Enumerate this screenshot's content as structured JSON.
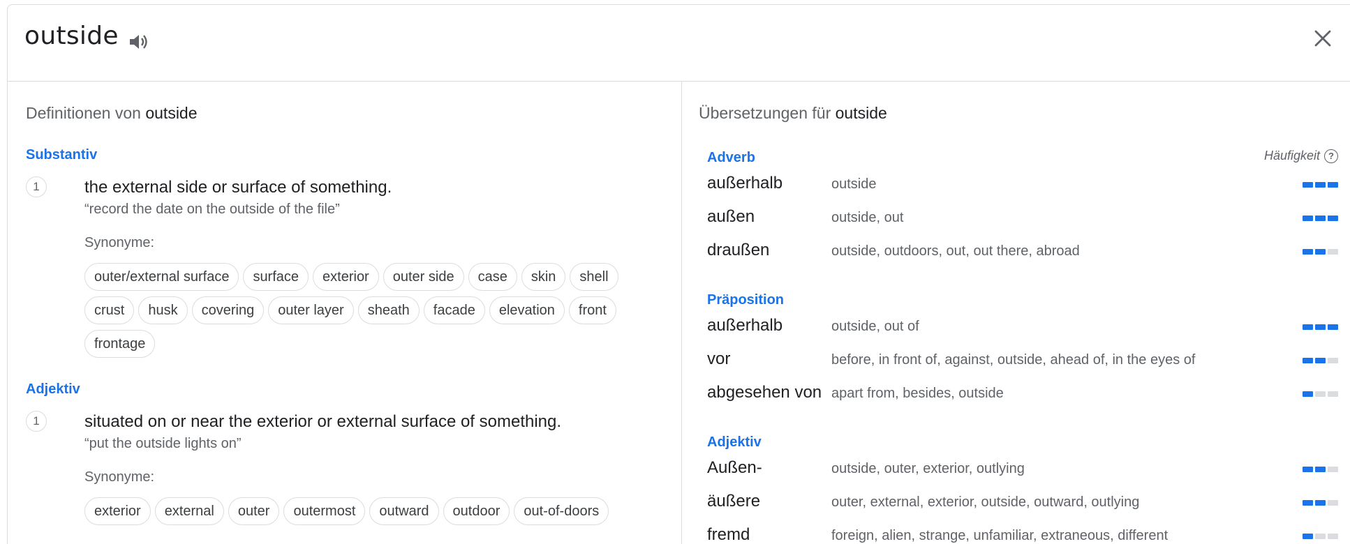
{
  "header": {
    "word": "outside"
  },
  "definitions": {
    "title_prefix": "Definitionen von",
    "title_word": "outside",
    "noun": {
      "pos": "Substantiv",
      "num": "1",
      "definition": "the external side or surface of something.",
      "example": "“record the date on the outside of the file”",
      "synonyms_label": "Synonyme:",
      "synonyms": [
        "outer/external surface",
        "surface",
        "exterior",
        "outer side",
        "case",
        "skin",
        "shell",
        "crust",
        "husk",
        "covering",
        "outer layer",
        "sheath",
        "facade",
        "elevation",
        "front",
        "frontage"
      ]
    },
    "adjective": {
      "pos": "Adjektiv",
      "num": "1",
      "definition": "situated on or near the exterior or external surface of something.",
      "example": "“put the outside lights on”",
      "synonyms_label": "Synonyme:",
      "synonyms": [
        "exterior",
        "external",
        "outer",
        "outermost",
        "outward",
        "outdoor",
        "out-of-doors"
      ]
    }
  },
  "translations": {
    "title_prefix": "Übersetzungen für",
    "title_word": "outside",
    "frequency_label": "Häufigkeit",
    "groups": [
      {
        "pos": "Adverb",
        "rows": [
          {
            "word": "außerhalb",
            "trans": "outside",
            "freq": 3
          },
          {
            "word": "außen",
            "trans": "outside, out",
            "freq": 3
          },
          {
            "word": "draußen",
            "trans": "outside, outdoors, out, out there, abroad",
            "freq": 2
          }
        ]
      },
      {
        "pos": "Präposition",
        "rows": [
          {
            "word": "außerhalb",
            "trans": "outside, out of",
            "freq": 3
          },
          {
            "word": "vor",
            "trans": "before, in front of, against, outside, ahead of, in the eyes of",
            "freq": 2
          },
          {
            "word": "abgesehen von",
            "trans": "apart from, besides, outside",
            "freq": 1
          }
        ]
      },
      {
        "pos": "Adjektiv",
        "rows": [
          {
            "word": "Außen-",
            "trans": "outside, outer, exterior, outlying",
            "freq": 2
          },
          {
            "word": "äußere",
            "trans": "outer, external, exterior, outside, outward, outlying",
            "freq": 2
          },
          {
            "word": "fremd",
            "trans": "foreign, alien, strange, unfamiliar, extraneous, different",
            "freq": 1
          }
        ]
      }
    ]
  },
  "colors": {
    "accent": "#1a73e8",
    "muted": "#5f6368",
    "border": "#dadce0"
  }
}
